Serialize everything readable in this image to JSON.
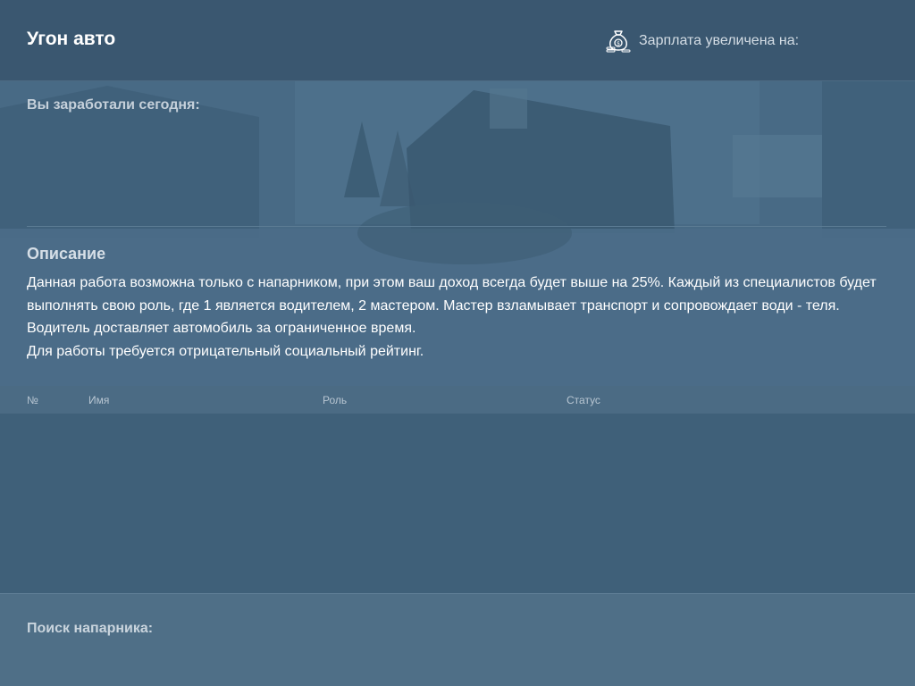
{
  "header": {
    "title": "Угон авто",
    "salary_label": "Зарплата увеличена на:",
    "salary_icon": "money-bag-icon"
  },
  "hero": {
    "earned_label": "Вы заработали сегодня:"
  },
  "description": {
    "title": "Описание",
    "lines": [
      "Данная работа возможна только с напарником, при этом ваш доход всегда будет выше на 25%. Каждый из специалистов будет выполнять свою роль, где 1 является водителем, 2 мастером. Мастер взламывает транспорт и сопровождает води - теля. Водитель доставляет автомобиль за ограниченное время.",
      "Для работы требуется отрицательный социальный рейтинг."
    ]
  },
  "table": {
    "columns": [
      "№",
      "Имя",
      "Роль",
      "Статус"
    ],
    "rows": []
  },
  "footer": {
    "search_label": "Поиск напарника:"
  },
  "colors": {
    "background": "#3f6079",
    "header": "#3a5770",
    "table_header": "#4b6b84",
    "footer": "#4f6f87"
  }
}
